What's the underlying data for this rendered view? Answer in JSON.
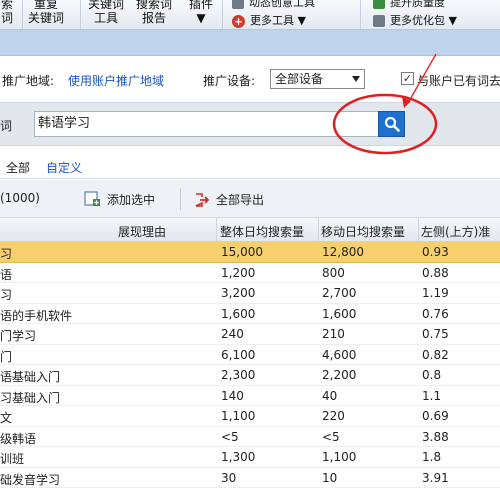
{
  "toolbar": {
    "items": [
      {
        "label": "索\n词"
      },
      {
        "label": "重复\n关键词"
      },
      {
        "label": "关键词\n工具"
      },
      {
        "label": "搜索词\n报告"
      },
      {
        "label": "插件\n▼"
      }
    ],
    "right_items": [
      {
        "label": "动态创意工具"
      },
      {
        "label": "更多工具 ▼"
      },
      {
        "label": "提升质量度"
      },
      {
        "label": "更多优化包 ▼"
      }
    ]
  },
  "region": {
    "label": "推广地域:",
    "link": "使用账户推广地域",
    "device_label": "推广设备:",
    "device_value": "全部设备",
    "checkbox_label": "与账户已有词去"
  },
  "keyword": {
    "label": "词",
    "value": "韩语学习"
  },
  "tabs": [
    {
      "label": "全部"
    },
    {
      "label": "自定义"
    }
  ],
  "actions": {
    "count": "(1000)",
    "add_label": "添加选中",
    "export_label": "全部导出"
  },
  "table": {
    "headers": [
      "展现理由",
      "整体日均搜索量",
      "移动日均搜索量",
      "左侧(上方)准入"
    ],
    "rows": [
      {
        "kw": "习",
        "overall": "15,000",
        "mobile": "12,800",
        "left": "0.93"
      },
      {
        "kw": "语",
        "overall": "1,200",
        "mobile": "800",
        "left": "0.88"
      },
      {
        "kw": "习",
        "overall": "3,200",
        "mobile": "2,700",
        "left": "1.19"
      },
      {
        "kw": "语的手机软件",
        "overall": "1,600",
        "mobile": "1,600",
        "left": "0.76"
      },
      {
        "kw": "门学习",
        "overall": "240",
        "mobile": "210",
        "left": "0.75"
      },
      {
        "kw": "门",
        "overall": "6,100",
        "mobile": "4,600",
        "left": "0.82"
      },
      {
        "kw": "语基础入门",
        "overall": "2,300",
        "mobile": "2,200",
        "left": "0.8"
      },
      {
        "kw": "习基础入门",
        "overall": "140",
        "mobile": "40",
        "left": "1.1"
      },
      {
        "kw": "文",
        "overall": "1,100",
        "mobile": "220",
        "left": "0.69"
      },
      {
        "kw": "级韩语",
        "overall": "<5",
        "mobile": "<5",
        "left": "3.88"
      },
      {
        "kw": "训班",
        "overall": "1,300",
        "mobile": "1,100",
        "left": "1.8"
      },
      {
        "kw": "础发音学习",
        "overall": "30",
        "mobile": "10",
        "left": "3.91"
      }
    ]
  },
  "colors": {
    "selected_row": "#f7cf6c",
    "search_button": "#1f6fcf",
    "link": "#1a55c7",
    "annotation": "#e21f1f"
  }
}
